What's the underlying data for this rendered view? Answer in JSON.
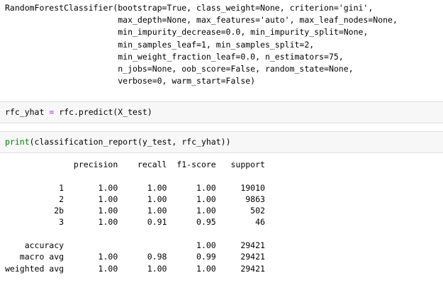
{
  "model_output": {
    "lines": [
      "RandomForestClassifier(bootstrap=True, class_weight=None, criterion='gini',",
      "                       max_depth=None, max_features='auto', max_leaf_nodes=None,",
      "                       min_impurity_decrease=0.0, min_impurity_split=None,",
      "                       min_samples_leaf=1, min_samples_split=2,",
      "                       min_weight_fraction_leaf=0.0, n_estimators=75,",
      "                       n_jobs=None, oob_score=False, random_state=None,",
      "                       verbose=0, warm_start=False)"
    ]
  },
  "cell_predict": {
    "var": "rfc_yhat",
    "eq": "=",
    "rhs": "rfc.predict(X_test)"
  },
  "cell_print": {
    "fn": "print",
    "args": "(classification_report(y_test, rfc_yhat))"
  },
  "report": {
    "lines": [
      "              precision    recall  f1-score   support",
      "",
      "           1       1.00      1.00      1.00     19010",
      "           2       1.00      1.00      1.00      9863",
      "          2b       1.00      1.00      1.00       502",
      "           3       1.00      0.91      0.95        46",
      "",
      "    accuracy                           1.00     29421",
      "   macro avg       1.00      0.98      0.99     29421",
      "weighted avg       1.00      1.00      1.00     29421"
    ]
  }
}
